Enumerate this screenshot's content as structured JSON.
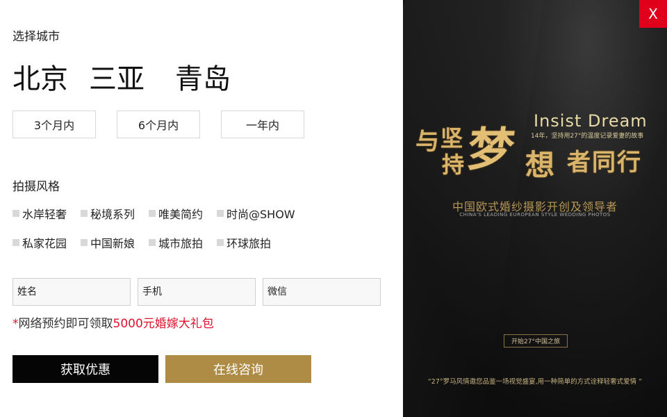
{
  "city_section": {
    "title": "选择城市",
    "cities": [
      "北京",
      "三亚",
      "青岛"
    ],
    "periods": [
      "3个月内",
      "6个月内",
      "一年内"
    ]
  },
  "style_section": {
    "title": "拍摄风格",
    "options": [
      "水岸轻奢",
      "秘境系列",
      "唯美简约",
      "时尚@SHOW",
      "私家花园",
      "中国新娘",
      "城市旅拍",
      "环球旅拍"
    ]
  },
  "form": {
    "name_placeholder": "姓名",
    "phone_placeholder": "手机",
    "wechat_placeholder": "微信"
  },
  "promo": {
    "star": "*",
    "text": "网络预约即可领取",
    "highlight": "5000元婚嫁大礼包"
  },
  "buttons": {
    "discount": "获取优惠",
    "consult": "在线咨询"
  },
  "close_label": "X",
  "ad": {
    "insist_dream": "Insist Dream",
    "sub_line": "14年，坚持用27°的温度记录爱妻的故事",
    "calligraphy": {
      "yu": "与",
      "jian": "坚",
      "chi": "持",
      "meng": "梦",
      "xiang": "想",
      "rest": "者同行"
    },
    "tagline_cn": "中国欧式婚纱摄影开创及领导者",
    "tagline_en": "CHINA'S LEADING EUROPEAN STYLE WEDDING PHOTOS",
    "journey_button": "开始27°中国之旅",
    "quote": "“27°罗马风情邀您品鉴一场视觉盛宴,用一种简单的方式诠释轻奢式爱情 ”"
  },
  "colors": {
    "accent_red": "#e0122c",
    "gold_button": "#ae8c46",
    "dark_button": "#050505",
    "close_bg": "#e0001b"
  }
}
